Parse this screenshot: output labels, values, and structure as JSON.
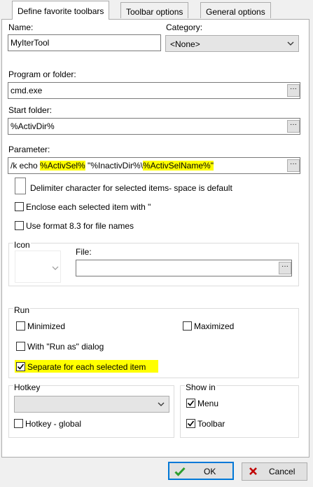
{
  "tabs": [
    {
      "label": "Define favorite toolbars",
      "active": true
    },
    {
      "label": "Toolbar options",
      "active": false
    },
    {
      "label": "General options",
      "active": false
    }
  ],
  "name": {
    "label": "Name:",
    "value": "MyIterTool"
  },
  "category": {
    "label": "Category:",
    "value": "<None>"
  },
  "program": {
    "label": "Program or folder:",
    "value": "cmd.exe"
  },
  "start_folder": {
    "label": "Start folder:",
    "value": "%ActivDir%"
  },
  "parameter": {
    "label": "Parameter:",
    "prefix": "/k echo ",
    "hl1": "%ActivSel%",
    "middle": " \"%InactivDir%\\",
    "hl2": "%ActivSelName%\"",
    "highlight_color": "#ffff00"
  },
  "delimiter": {
    "label": "Delimiter character for selected items- space is default",
    "value": ""
  },
  "enclose": {
    "label": "Enclose each selected item with \"",
    "checked": false
  },
  "format83": {
    "label": "Use format 8.3 for file names",
    "checked": false
  },
  "icon": {
    "group_label": "Icon",
    "file_label": "File:",
    "file_value": ""
  },
  "run": {
    "group_label": "Run",
    "minimized": {
      "label": "Minimized",
      "checked": false
    },
    "maximized": {
      "label": "Maximized",
      "checked": false
    },
    "run_as": {
      "label": "With \"Run as\" dialog",
      "checked": false
    },
    "separate": {
      "label": "Separate for each selected item",
      "checked": true
    }
  },
  "hotkey": {
    "group_label": "Hotkey",
    "value": "",
    "global": {
      "label": "Hotkey - global",
      "checked": false
    }
  },
  "show_in": {
    "group_label": "Show in",
    "menu": {
      "label": "Menu",
      "checked": true
    },
    "toolbar": {
      "label": "Toolbar",
      "checked": true
    }
  },
  "buttons": {
    "ok": {
      "label": "OK",
      "icon": "check-icon",
      "color": "#2e9e2e"
    },
    "cancel": {
      "label": "Cancel",
      "icon": "x-icon",
      "color": "#c00000"
    }
  },
  "accent_color": "#0078d7"
}
